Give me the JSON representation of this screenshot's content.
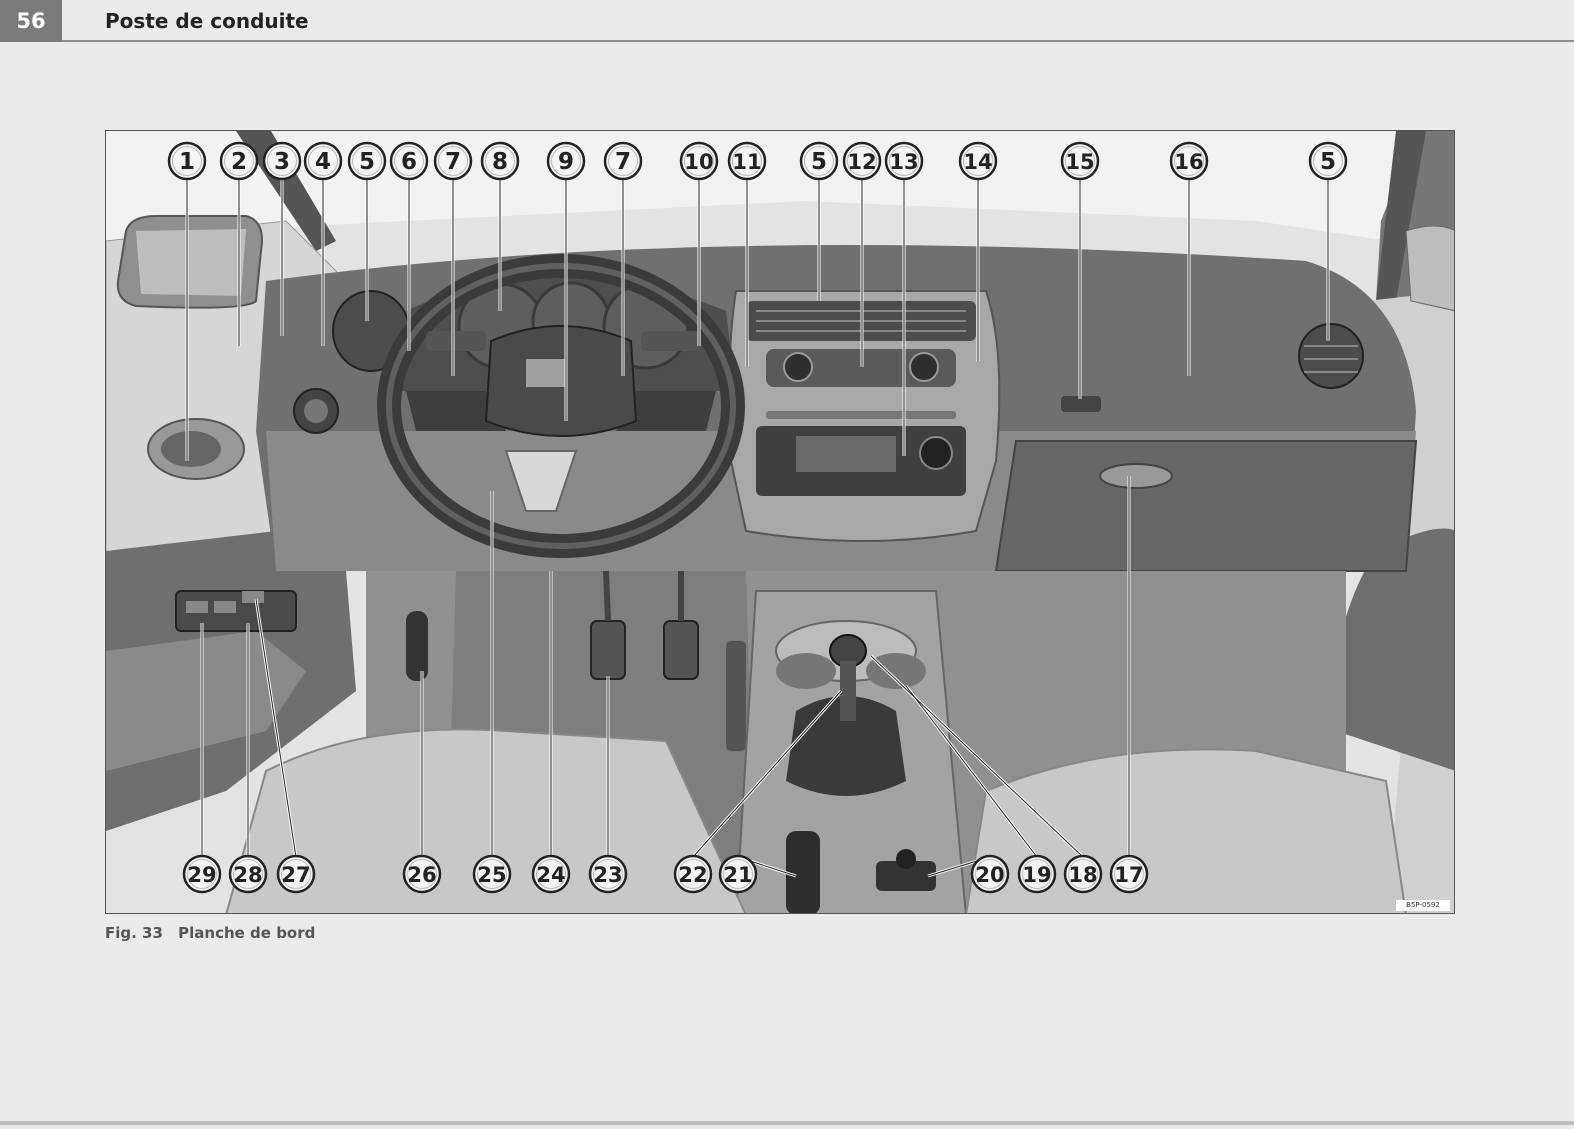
{
  "header": {
    "page_number": "56",
    "section_title": "Poste de conduite"
  },
  "figure": {
    "caption_label": "Fig. 33",
    "caption_text": "Planche de bord",
    "ref_code": "B5P-0592",
    "callouts_top": [
      "1",
      "2",
      "3",
      "4",
      "5",
      "6",
      "7",
      "8",
      "9",
      "7",
      "10",
      "11",
      "5",
      "12",
      "13",
      "14",
      "15",
      "16",
      "5"
    ],
    "callouts_bottom": [
      "29",
      "28",
      "27",
      "26",
      "25",
      "24",
      "23",
      "22",
      "21",
      "20",
      "19",
      "18",
      "17"
    ]
  }
}
